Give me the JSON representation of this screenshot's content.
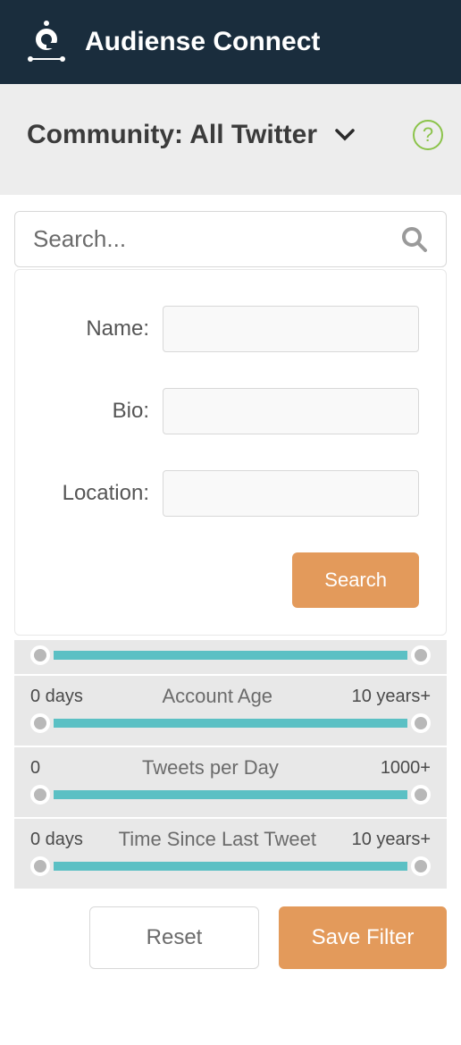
{
  "header": {
    "title": "Audiense Connect"
  },
  "subheader": {
    "title": "Community: All Twitter"
  },
  "search": {
    "placeholder": "Search..."
  },
  "form": {
    "name_label": "Name:",
    "bio_label": "Bio:",
    "location_label": "Location:",
    "search_button": "Search"
  },
  "sliders": [
    {
      "min": "",
      "title": "",
      "max": ""
    },
    {
      "min": "0 days",
      "title": "Account Age",
      "max": "10 years+"
    },
    {
      "min": "0",
      "title": "Tweets per Day",
      "max": "1000+"
    },
    {
      "min": "0 days",
      "title": "Time Since Last Tweet",
      "max": "10 years+"
    }
  ],
  "footer": {
    "reset": "Reset",
    "save": "Save Filter"
  }
}
